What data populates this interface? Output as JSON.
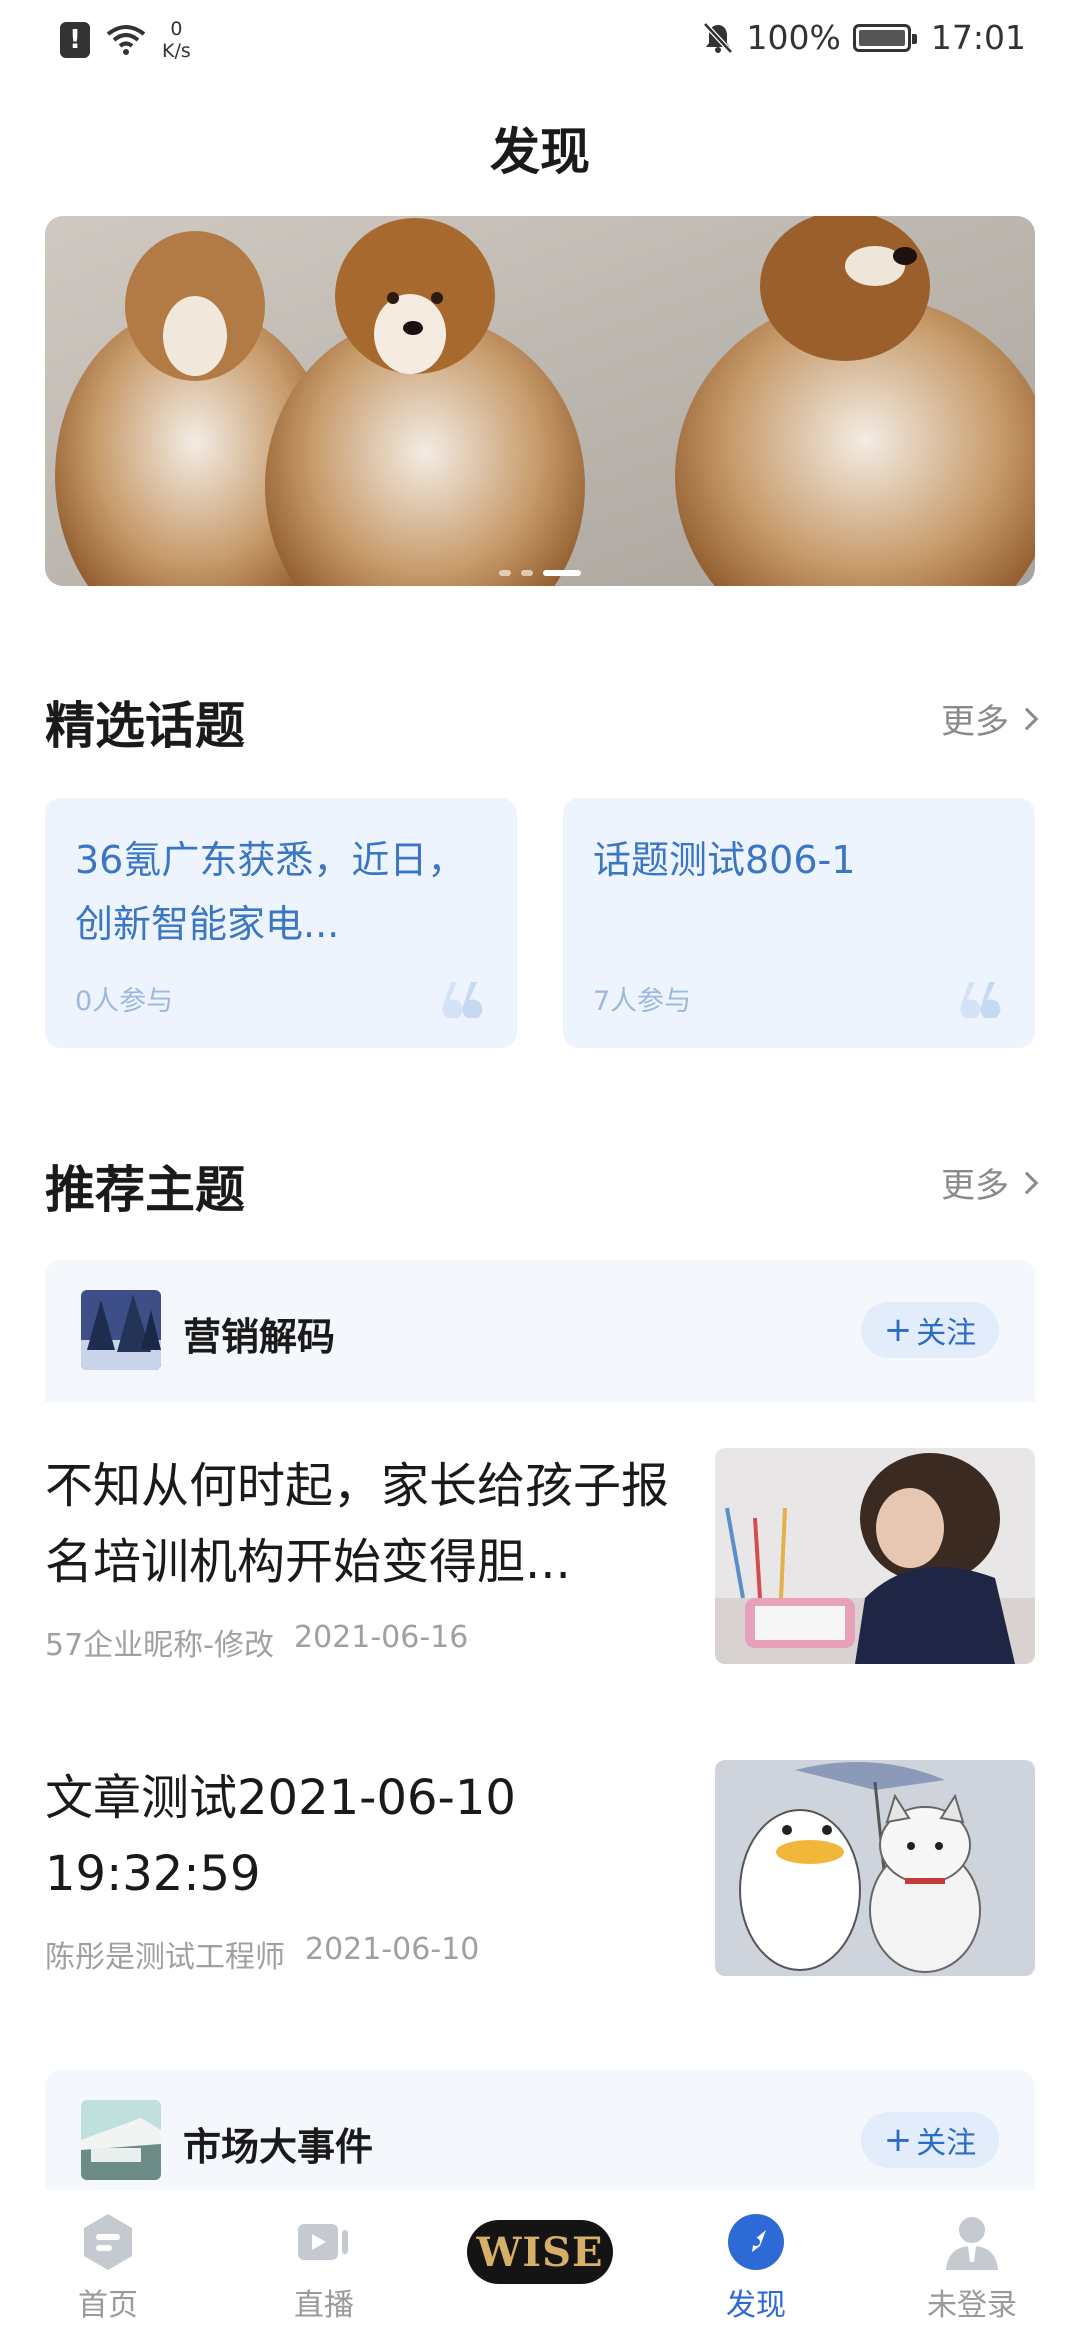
{
  "status_bar": {
    "net_speed_value": "0",
    "net_speed_unit": "K/s",
    "battery": "100%",
    "time": "17:01"
  },
  "header": {
    "title": "发现"
  },
  "banner": {
    "active_index": 2,
    "slide_count": 3
  },
  "featured_topics": {
    "title": "精选话题",
    "more_label": "更多",
    "items": [
      {
        "title": "36氪广东获悉，近日，创新智能家电...",
        "participants": "0人参与"
      },
      {
        "title": "话题测试806-1",
        "participants": "7人参与"
      }
    ]
  },
  "recommended_themes": {
    "title": "推荐主题",
    "more_label": "更多",
    "follow_label": "关注",
    "themes": [
      {
        "name": "营销解码"
      },
      {
        "name": "市场大事件"
      }
    ]
  },
  "articles": [
    {
      "title": "不知从何时起，家长给孩子报名培训机构开始变得胆...",
      "author": "57企业昵称-修改",
      "date": "2021-06-16"
    },
    {
      "title": "文章测试2021-06-10 19:32:59",
      "author": "陈彤是测试工程师",
      "date": "2021-06-10"
    }
  ],
  "bottom_nav": {
    "items": [
      {
        "label": "首页",
        "icon": "home-icon"
      },
      {
        "label": "直播",
        "icon": "live-video-icon"
      },
      {
        "label": "WISE",
        "icon": "wise-logo"
      },
      {
        "label": "发现",
        "icon": "discover-compass-icon"
      },
      {
        "label": "未登录",
        "icon": "user-icon"
      }
    ],
    "active": "发现"
  }
}
